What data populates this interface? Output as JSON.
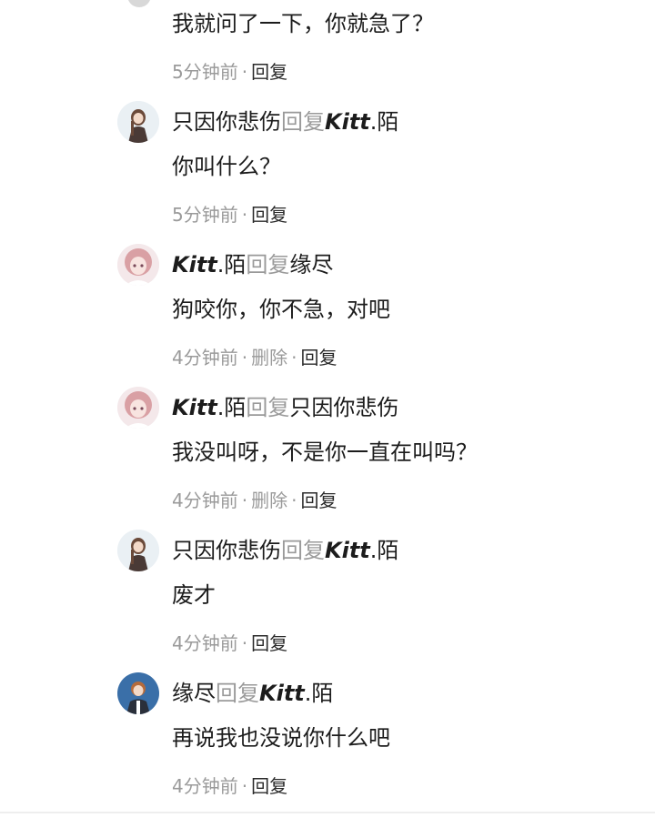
{
  "thread": {
    "top_reply": {
      "content": "我就问了一下，你就急了？",
      "time": "5分钟前",
      "reply_label": "回复"
    },
    "replies": [
      {
        "author": "只因你悲伤",
        "author_avatar": "anime-girl-dark-hair-avatar",
        "reply_word": "回复",
        "target_latin": "Kitt",
        "target_tail": ".陌",
        "content": "你叫什么？",
        "time": "5分钟前",
        "reply_label": "回复"
      },
      {
        "author_latin": "Kitt",
        "author_tail": ".陌",
        "author_avatar": "anime-girl-pink-hair-avatar",
        "reply_word": "回复",
        "target": "缘尽",
        "content": "狗咬你，你不急，对吧",
        "time": "4分钟前",
        "delete_label": "删除",
        "reply_label": "回复"
      },
      {
        "author_latin": "Kitt",
        "author_tail": ".陌",
        "author_avatar": "anime-girl-pink-hair-avatar",
        "reply_word": "回复",
        "target": "只因你悲伤",
        "content": "我没叫呀，不是你一直在叫吗？",
        "time": "4分钟前",
        "delete_label": "删除",
        "reply_label": "回复"
      },
      {
        "author": "只因你悲伤",
        "author_avatar": "anime-girl-dark-hair-avatar",
        "reply_word": "回复",
        "target_latin": "Kitt",
        "target_tail": ".陌",
        "content": "废才",
        "time": "4分钟前",
        "reply_label": "回复"
      },
      {
        "author": "缘尽",
        "author_avatar": "anime-boy-blue-background-avatar",
        "reply_word": "回复",
        "target_latin": "Kitt",
        "target_tail": ".陌",
        "content": "再说我也没说你什么吧",
        "time": "4分钟前",
        "reply_label": "回复"
      }
    ]
  },
  "colors": {
    "text": "#1c1c1c",
    "muted": "#9a9a9a",
    "background": "#ffffff"
  }
}
